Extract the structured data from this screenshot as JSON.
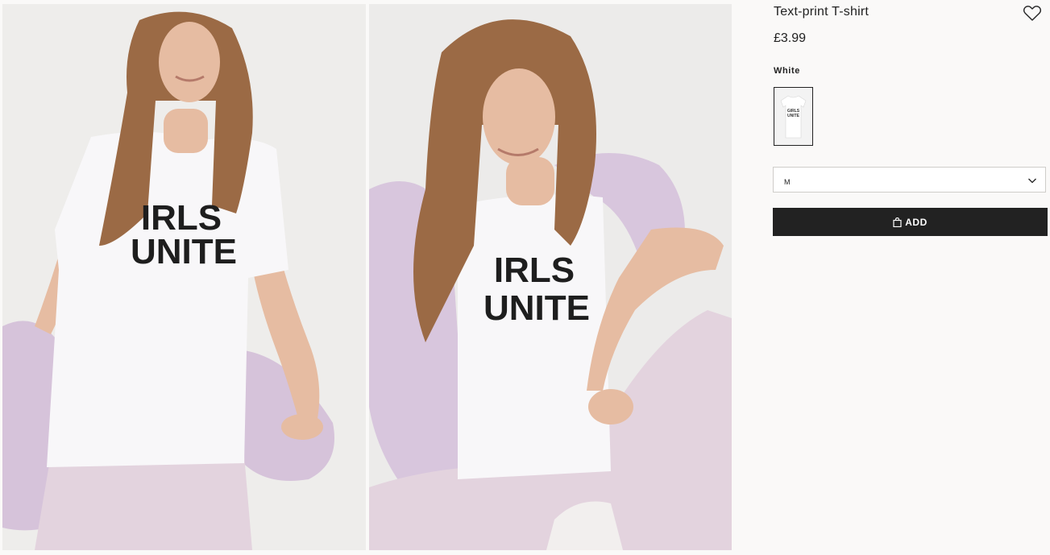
{
  "product": {
    "title": "Text-print T-shirt",
    "price": "£3.99",
    "color_label": "White",
    "selected_size": "M",
    "add_label": "ADD"
  },
  "gallery": {
    "images": [
      {
        "print_text_line1": "IRLS",
        "print_text_line2": "UNITE"
      },
      {
        "print_text_line1": "IRLS",
        "print_text_line2": "UNITE"
      }
    ]
  },
  "swatch": {
    "print_text_line1": "GIRLS",
    "print_text_line2": "UNITE"
  },
  "icons": {
    "favorite": "heart-icon",
    "dropdown": "chevron-down-icon",
    "bag": "shopping-bag-icon"
  },
  "colors": {
    "background": "#faf9f8",
    "button": "#222222",
    "tshirt": "#f7f6f8",
    "lilac": "#d8c6dd",
    "hair": "#9b6a45",
    "skin": "#e6bca2"
  }
}
